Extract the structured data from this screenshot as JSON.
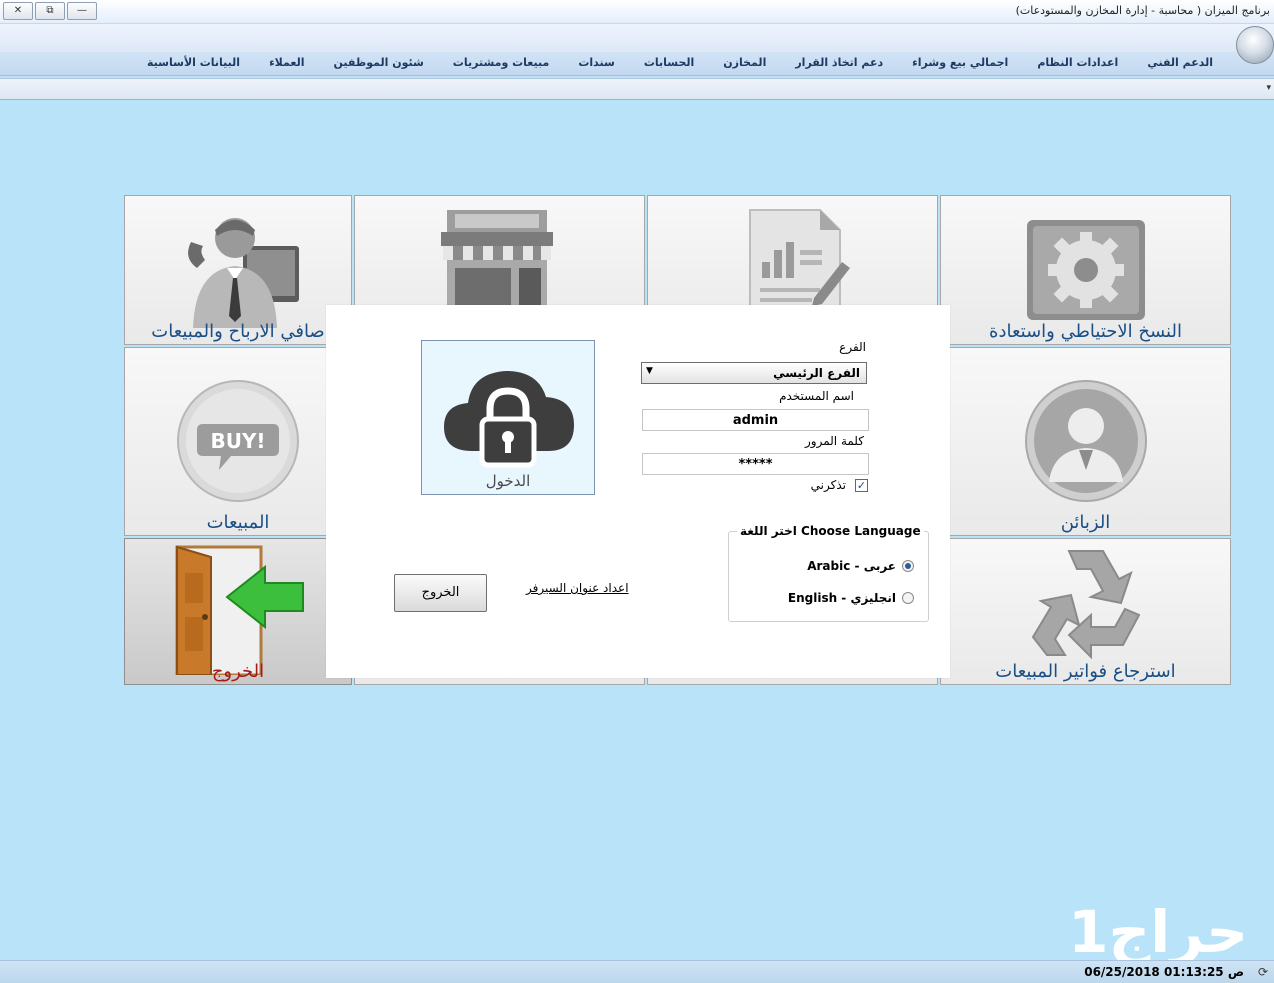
{
  "window": {
    "title": "برنامج الميزان ( محاسبة - إدارة المخازن والمستودعات)",
    "controls": [
      "✕",
      "⧉",
      "—"
    ]
  },
  "menu": {
    "items": [
      "البيانات الأساسية",
      "العملاء",
      "شئون الموظفين",
      "مبيعات ومشتريات",
      "سندات",
      "الحسابات",
      "المخازن",
      "دعم اتخاذ القرار",
      "اجمالي بيع وشراء",
      "اعدادات النظام",
      "الدعم الفني"
    ]
  },
  "tiles": {
    "backup": "النسخ الاحتياطي واستعادة",
    "profits": "صافي الارباح والمبيعات",
    "customers": "الزبائن",
    "sales": "المبيعات",
    "returns": "استرجاع فواتير المبيعات",
    "exit": "الخروج",
    "buy_badge": "BUY!"
  },
  "login": {
    "tile_label": "الدخول",
    "branch_label": "الفرع",
    "branch_value": "الفرع الرئيسي",
    "username_label": "اسم المستخدم",
    "username_value": "admin",
    "password_label": "كلمة المرور",
    "password_value": "*****",
    "remember_label": "تذكرني",
    "remember_checked": true,
    "language_title": "اختر اللغة Choose Language",
    "lang_arabic": "Arabic - عربى",
    "lang_english": "English - انجليزي",
    "selected_language": "arabic",
    "exit_button": "الخروج",
    "server_link": "اعداد عنوان السيرفر"
  },
  "watermark": "حراج1",
  "status": {
    "datetime": "06/25/2018 01:13:25 ص"
  }
}
